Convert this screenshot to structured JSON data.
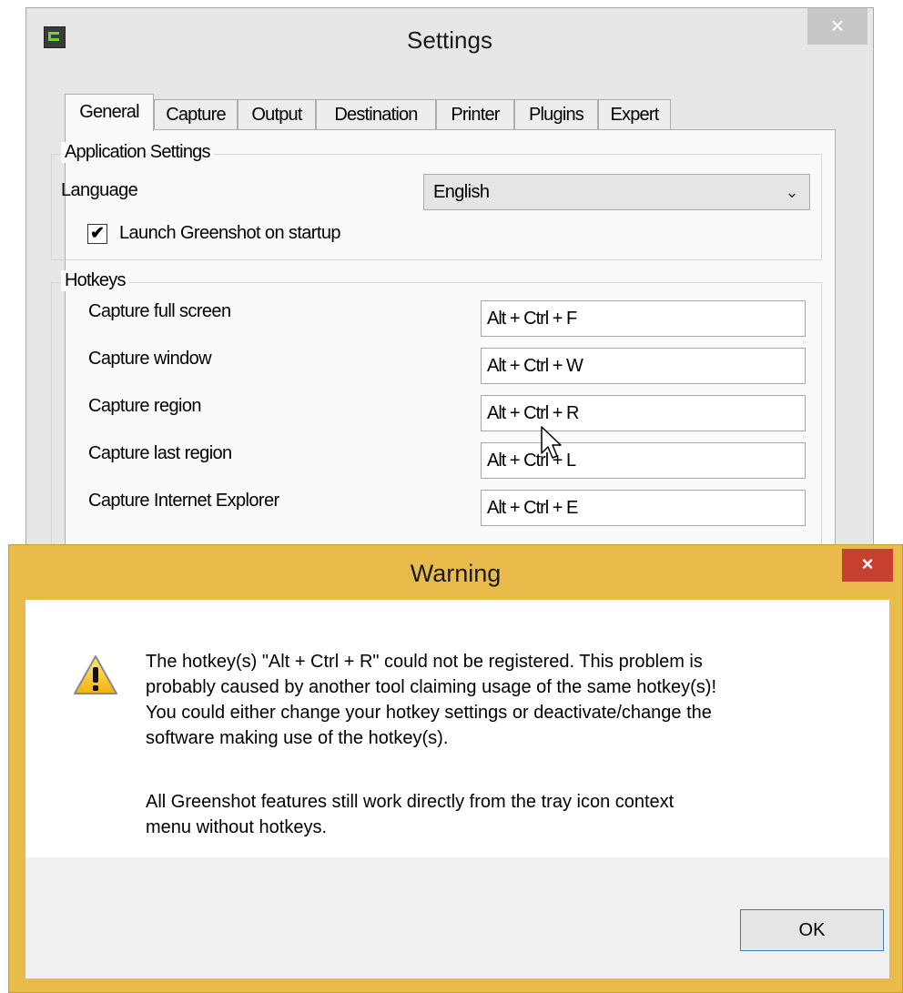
{
  "settings": {
    "title": "Settings",
    "close_glyph": "×",
    "tabs": [
      "General",
      "Capture",
      "Output",
      "Destination",
      "Printer",
      "Plugins",
      "Expert"
    ],
    "app_settings": {
      "legend": "Application Settings",
      "language_label": "Language",
      "language_value": "English",
      "launch_label": "Launch Greenshot on startup",
      "launch_checked": true
    },
    "hotkeys": {
      "legend": "Hotkeys",
      "rows": [
        {
          "label": "Capture full screen",
          "value": "Alt + Ctrl + F"
        },
        {
          "label": "Capture window",
          "value": "Alt + Ctrl + W"
        },
        {
          "label": "Capture region",
          "value": "Alt + Ctrl + R"
        },
        {
          "label": "Capture last region",
          "value": "Alt + Ctrl + L"
        },
        {
          "label": "Capture Internet Explorer",
          "value": "Alt + Ctrl + E"
        }
      ]
    }
  },
  "warning": {
    "title": "Warning",
    "close_glyph": "×",
    "message_line1": "The hotkey(s) \"Alt + Ctrl + R\" could not be registered. This problem is",
    "message_line2": "probably caused by another tool claiming usage of the same hotkey(s)!",
    "message_line3": "You could either change your hotkey settings or deactivate/change the",
    "message_line4": "software making use of the hotkey(s).",
    "note_line1": "All Greenshot features still work directly from the tray icon context",
    "note_line2": "menu without hotkeys.",
    "ok_label": "OK",
    "title_bar_color": "#e8bb4a",
    "close_color": "#c7402f"
  },
  "icons": {
    "app": "greenshot-icon",
    "warning": "warning-triangle-icon",
    "dropdown": "chevron-down-icon",
    "cursor": "mouse-pointer-icon"
  }
}
